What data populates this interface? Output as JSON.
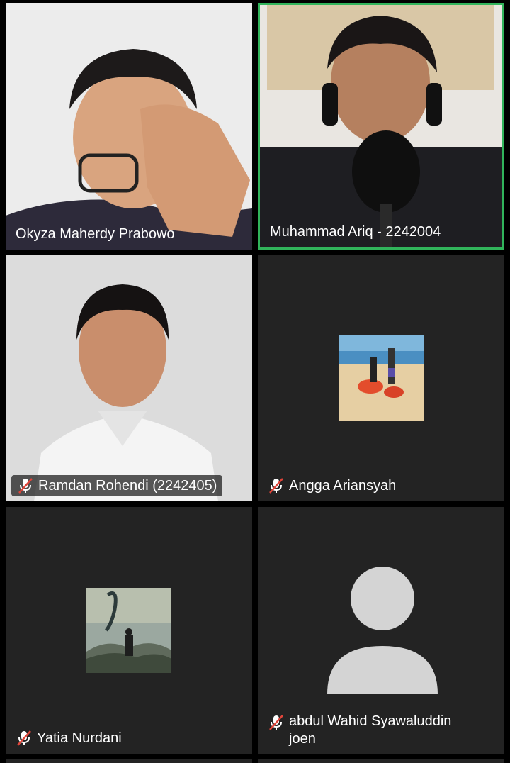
{
  "participants": [
    {
      "name": "Okyza Maherdy Prabowo",
      "muted": false,
      "active_speaker": false,
      "video": "camera"
    },
    {
      "name": "Muhammad Ariq - 2242004",
      "muted": false,
      "active_speaker": true,
      "video": "camera"
    },
    {
      "name": "Ramdan Rohendi (2242405)",
      "muted": true,
      "active_speaker": false,
      "video": "camera"
    },
    {
      "name": "Angga Ariansyah",
      "muted": true,
      "active_speaker": false,
      "video": "profile-picture"
    },
    {
      "name": "Yatia Nurdani",
      "muted": true,
      "active_speaker": false,
      "video": "profile-picture"
    },
    {
      "name": "abdul Wahid Syawaluddin joen",
      "muted": true,
      "active_speaker": false,
      "video": "default-avatar"
    }
  ],
  "colors": {
    "tile_background": "#232323",
    "active_speaker_border": "#31b45b",
    "mute_slash": "#e0453a",
    "avatar": "#d4d4d4"
  }
}
